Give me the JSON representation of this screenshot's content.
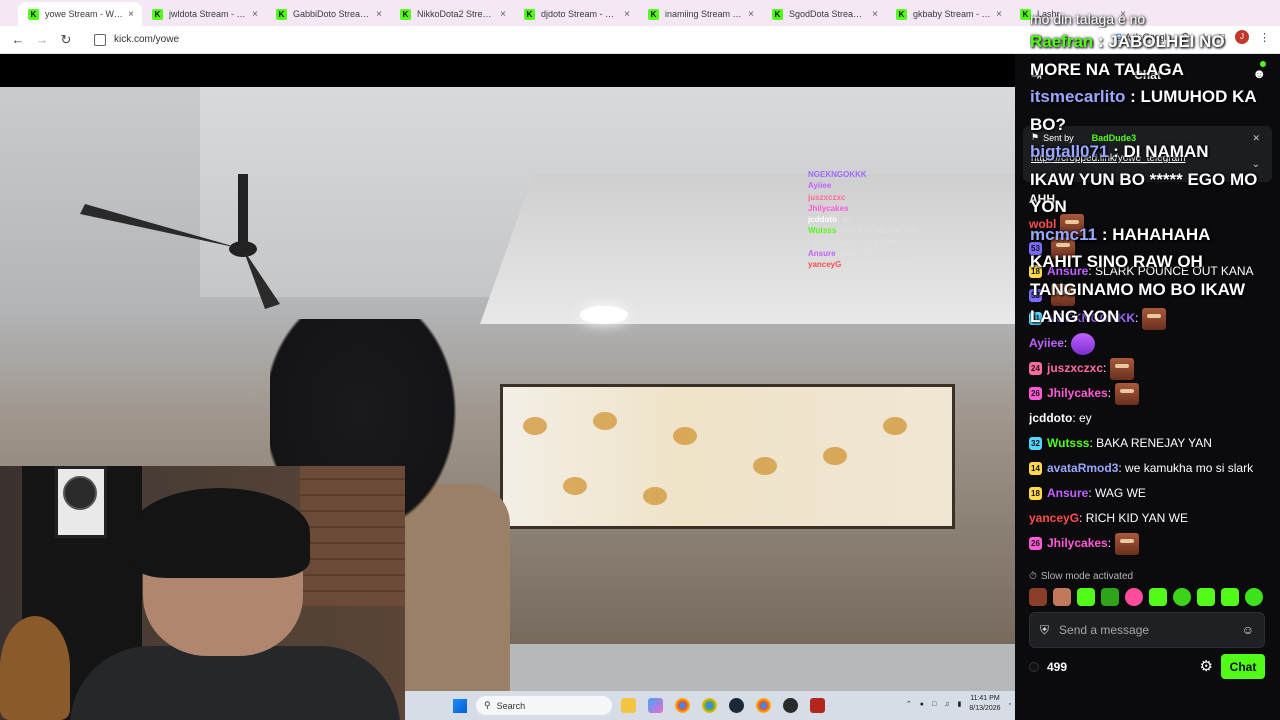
{
  "browser": {
    "tabs": [
      {
        "label": "yowe Stream - Watch L",
        "active": true
      },
      {
        "label": "jwldota Stream - Watch",
        "active": false
      },
      {
        "label": "GabbiDoto Stream - W",
        "active": false
      },
      {
        "label": "NikkoDota2 Stream - W",
        "active": false
      },
      {
        "label": "djdoto Stream - Watch",
        "active": false
      },
      {
        "label": "inamiing Stream - Watc",
        "active": false
      },
      {
        "label": "SgodDota Stream - Wat",
        "active": false
      },
      {
        "label": "gkbaby Stream - Watc",
        "active": false
      },
      {
        "label": "Lashr",
        "active": false
      }
    ],
    "url": "kick.com/yowe",
    "ask_google": "Ask Google",
    "profile_initial": "J"
  },
  "video_overlay_chat": [
    {
      "user": "NGEKNGOKKK",
      "text": ":",
      "color": "#9c6bff"
    },
    {
      "user": "Ayiiee",
      "text": ":",
      "color": "#c061ff"
    },
    {
      "user": "juszxczxc",
      "text": ":",
      "color": "#ff6b9c"
    },
    {
      "user": "Jhilycakes",
      "text": ":",
      "color": "#ff5ad6"
    },
    {
      "user": "jcddoto",
      "text": ": ey",
      "color": "#ffffff"
    },
    {
      "user": "Wutsss",
      "text": ": BAKA RENEJAY YAN",
      "color": "#53fc18"
    },
    {
      "user": "",
      "text": ": we kamukha mo si slark",
      "color": "#9aa7ff"
    },
    {
      "user": "Ansure",
      "text": ": WAG WE",
      "color": "#c061ff"
    },
    {
      "user": "yanceyG",
      "text": ": RICH KID YAN WE",
      "color": "#ff4d4d"
    }
  ],
  "taskbar": {
    "search_label": "Search",
    "time": "11:41 PM",
    "date": "8/13/2026"
  },
  "chat": {
    "title": "Chat",
    "pinned": {
      "sent_by_label": "Sent by",
      "user": "BadDude3",
      "link": "https://cropped.link/yowe_telegram"
    },
    "messages": [
      {
        "badge": "",
        "badge_color": "",
        "user": "AHH",
        "user_color": "#ffffff",
        "text": "",
        "emote": false
      },
      {
        "badge": "",
        "badge_color": "",
        "user": "wobl",
        "user_color": "#ff4d4d",
        "text": "",
        "emote": true
      },
      {
        "badge": "53",
        "badge_color": "#7b6bff",
        "user": "",
        "user_color": "#ffffff",
        "text": "",
        "emote": true
      },
      {
        "badge": "18",
        "badge_color": "#ffd84d",
        "user": "Ansure",
        "user_color": "#c061ff",
        "text": ": SLARK POUNCE OUT KANA",
        "emote": false
      },
      {
        "badge": "53",
        "badge_color": "#7b6bff",
        "user": "",
        "user_color": "#ffffff",
        "text": "",
        "emote": true
      },
      {
        "badge": "31",
        "badge_color": "#53d6ff",
        "user": "NGEKNGOKKK",
        "user_color": "#9c6bff",
        "text": ":",
        "emote": true
      },
      {
        "badge": "",
        "badge_color": "",
        "user": "Ayiiee",
        "user_color": "#c061ff",
        "text": ":",
        "emote": "purple"
      },
      {
        "badge": "24",
        "badge_color": "#ff6b9c",
        "user": "juszxczxc",
        "user_color": "#ff6b9c",
        "text": ":",
        "emote": true
      },
      {
        "badge": "26",
        "badge_color": "#ff5ad6",
        "user": "Jhilycakes",
        "user_color": "#ff5ad6",
        "text": ":",
        "emote": true
      },
      {
        "badge": "",
        "badge_color": "",
        "user": "jcddoto",
        "user_color": "#ffffff",
        "text": ": ey",
        "emote": false
      },
      {
        "badge": "32",
        "badge_color": "#53d6ff",
        "user": "Wutsss",
        "user_color": "#53fc18",
        "text": ": BAKA RENEJAY YAN",
        "emote": false
      },
      {
        "badge": "14",
        "badge_color": "#ffd84d",
        "user": "avataRmod3",
        "user_color": "#9aa7ff",
        "text": ": we kamukha mo si slark",
        "emote": false
      },
      {
        "badge": "18",
        "badge_color": "#ffd84d",
        "user": "Ansure",
        "user_color": "#c061ff",
        "text": ": WAG WE",
        "emote": false
      },
      {
        "badge": "",
        "badge_color": "",
        "user": "yanceyG",
        "user_color": "#ff4d4d",
        "text": ": RICH KID YAN WE",
        "emote": false
      },
      {
        "badge": "26",
        "badge_color": "#ff5ad6",
        "user": "Jhilycakes",
        "user_color": "#ff5ad6",
        "text": ":",
        "emote": true
      }
    ],
    "slow_mode": "Slow mode activated",
    "input_placeholder": "Send a message",
    "points": "499",
    "chat_button": "Chat",
    "accent": "#53fc18"
  },
  "overlay_captions": [
    {
      "user": "",
      "text": "mo din talaga e no",
      "style": "small"
    },
    {
      "user": "Raefran",
      "text": " : JABOLHEI NO",
      "color": "g"
    },
    {
      "user": "",
      "text": "MORE NA TALAGA",
      "color": "w"
    },
    {
      "user": "itsmecarlito",
      "text": " : LUMUHOD KA",
      "color": "b"
    },
    {
      "user": "",
      "text": "BO?",
      "color": "w"
    },
    {
      "user": "bigtall071",
      "text": " : DI NAMAN",
      "color": "b"
    },
    {
      "user": "",
      "text": "IKAW YUN BO ***** EGO MO",
      "color": "w"
    },
    {
      "user": "",
      "text": "YON",
      "color": "w"
    },
    {
      "user": "mcmc11",
      "text": " : HAHAHAHA",
      "color": "b"
    },
    {
      "user": "",
      "text": "KAHIT SINO RAW OH",
      "color": "w"
    },
    {
      "user": "",
      "text": "TANGINAMO MO BO IKAW",
      "color": "w"
    },
    {
      "user": "",
      "text": "LANG YON",
      "color": "w"
    }
  ]
}
